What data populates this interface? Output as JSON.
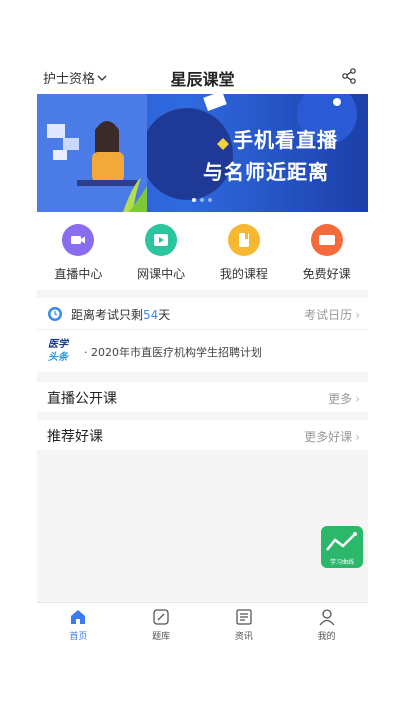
{
  "header": {
    "qualification": "护士资格",
    "title": "星辰课堂"
  },
  "banner": {
    "line1": "手机看直播",
    "line2": "与名师近距离",
    "page_count": 3,
    "active_page": 1
  },
  "quicknav": [
    {
      "label": "直播中心",
      "icon": "live-camera-icon",
      "color": "#8a6cf0"
    },
    {
      "label": "网课中心",
      "icon": "video-play-icon",
      "color": "#2dc5a0"
    },
    {
      "label": "我的课程",
      "icon": "book-icon",
      "color": "#f5b830"
    },
    {
      "label": "免费好课",
      "icon": "free-tag-icon",
      "color": "#f56a3a"
    }
  ],
  "countdown": {
    "prefix": "距离考试只剩",
    "days": "54",
    "suffix": "天",
    "calendar_link": "考试日历"
  },
  "news": {
    "logo_text_line1": "医学",
    "logo_text_line2": "头条",
    "headline": "2020年市直医疗机构学生招聘计划"
  },
  "live_section": {
    "title": "直播公开课",
    "more": "更多"
  },
  "recommend_section": {
    "title": "推荐好课",
    "more": "更多好课"
  },
  "study_badge": {
    "label": "学习曲线"
  },
  "tabbar": [
    {
      "label": "首页",
      "icon": "home-icon",
      "active": true
    },
    {
      "label": "题库",
      "icon": "question-bank-icon",
      "active": false
    },
    {
      "label": "资讯",
      "icon": "news-icon",
      "active": false
    },
    {
      "label": "我的",
      "icon": "profile-icon",
      "active": false
    }
  ],
  "colors": {
    "accent": "#3a7bf0",
    "countdown_days": "#3a8bf0"
  }
}
